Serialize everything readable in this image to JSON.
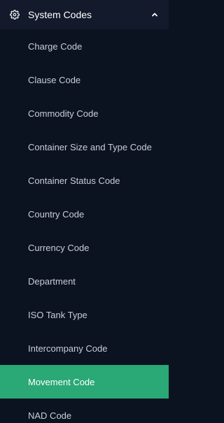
{
  "group": {
    "label": "System Codes",
    "icon": "gear-icon",
    "chevron_icon": "chevron-up-icon",
    "expanded": true
  },
  "colors": {
    "background": "#0c1320",
    "header_background": "#121a2b",
    "active_background": "#2aa876",
    "item_text": "#c7ced8",
    "active_text": "#ffffff"
  },
  "items": [
    {
      "label": "Charge Code",
      "active": false
    },
    {
      "label": "Clause Code",
      "active": false
    },
    {
      "label": "Commodity Code",
      "active": false
    },
    {
      "label": "Container Size and Type Code",
      "active": false
    },
    {
      "label": "Container Status Code",
      "active": false
    },
    {
      "label": "Country Code",
      "active": false
    },
    {
      "label": "Currency Code",
      "active": false
    },
    {
      "label": "Department",
      "active": false
    },
    {
      "label": "ISO Tank Type",
      "active": false
    },
    {
      "label": "Intercompany Code",
      "active": false
    },
    {
      "label": "Movement Code",
      "active": true
    },
    {
      "label": "NAD Code",
      "active": false
    }
  ]
}
